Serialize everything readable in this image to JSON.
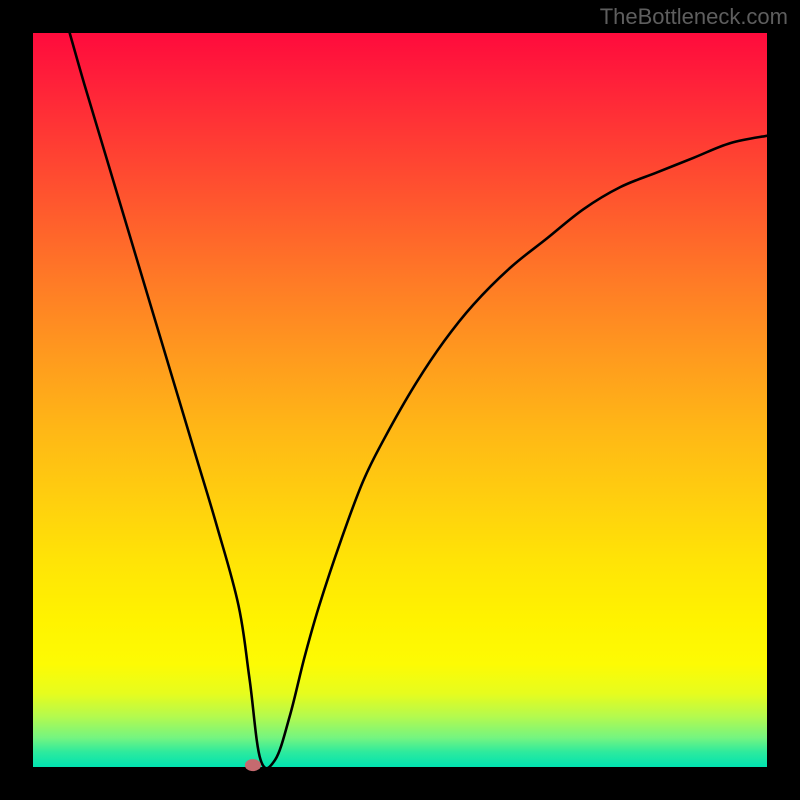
{
  "watermark": "TheBottleneck.com",
  "chart_data": {
    "type": "line",
    "title": "",
    "xlabel": "",
    "ylabel": "",
    "xlim": [
      0,
      100
    ],
    "ylim": [
      0,
      100
    ],
    "grid": false,
    "legend": false,
    "series": [
      {
        "name": "curve",
        "x": [
          5,
          7,
          10,
          13,
          16,
          19,
          22,
          25,
          28,
          29.5,
          31,
          33,
          35,
          37,
          39,
          42,
          45,
          48,
          52,
          56,
          60,
          65,
          70,
          75,
          80,
          85,
          90,
          95,
          100
        ],
        "y": [
          100,
          93,
          83,
          73,
          63,
          53,
          43,
          33,
          22,
          12,
          1,
          1,
          7,
          15,
          22,
          31,
          39,
          45,
          52,
          58,
          63,
          68,
          72,
          76,
          79,
          81,
          83,
          85,
          86
        ]
      }
    ],
    "marker": {
      "x": 30,
      "y": 0.3,
      "color": "#c56a6f",
      "w": 2.2,
      "h": 1.6
    }
  },
  "colors": {
    "frame": "#000000",
    "curve": "#000000",
    "marker": "#c56a6f"
  }
}
